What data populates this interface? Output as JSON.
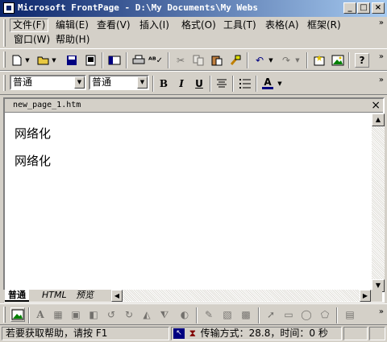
{
  "window": {
    "title": "Microsoft FrontPage - D:\\My Documents\\My Webs"
  },
  "menu": [
    {
      "label": "文件(F)"
    },
    {
      "label": "编辑(E)"
    },
    {
      "label": "查看(V)"
    },
    {
      "label": "插入(I)"
    },
    {
      "label": "格式(O)"
    },
    {
      "label": "工具(T)"
    },
    {
      "label": "表格(A)"
    },
    {
      "label": "框架(R)"
    },
    {
      "label": "窗口(W)"
    },
    {
      "label": "帮助(H)"
    }
  ],
  "format": {
    "style": "普通",
    "font": "普通"
  },
  "document": {
    "filename": "new_page_1.htm",
    "lines": [
      "网络化",
      "网络化"
    ]
  },
  "view_tabs": [
    "普通",
    "HTML",
    "预览"
  ],
  "status": {
    "help": "若要获取帮助，请按 F1",
    "transfer": "传输方式：28.8，时间：0 秒"
  },
  "colors": {
    "title_start": "#0a246a",
    "title_end": "#a6caf0",
    "face": "#d4d0c8"
  }
}
